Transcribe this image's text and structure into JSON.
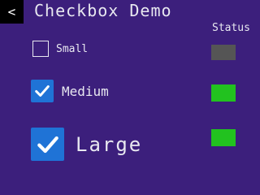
{
  "header": {
    "back_icon": "chevron-left-icon",
    "back_glyph": "<",
    "title": "Checkbox Demo",
    "status_label": "Status"
  },
  "colors": {
    "background": "#3c1f7c",
    "checkbox_checked": "#1f73d6",
    "status_on": "#22c21f",
    "status_off": "#555555"
  },
  "items": [
    {
      "label": "Small",
      "checked": false,
      "status": "off"
    },
    {
      "label": "Medium",
      "checked": true,
      "status": "on"
    },
    {
      "label": "Large",
      "checked": true,
      "status": "on"
    }
  ]
}
